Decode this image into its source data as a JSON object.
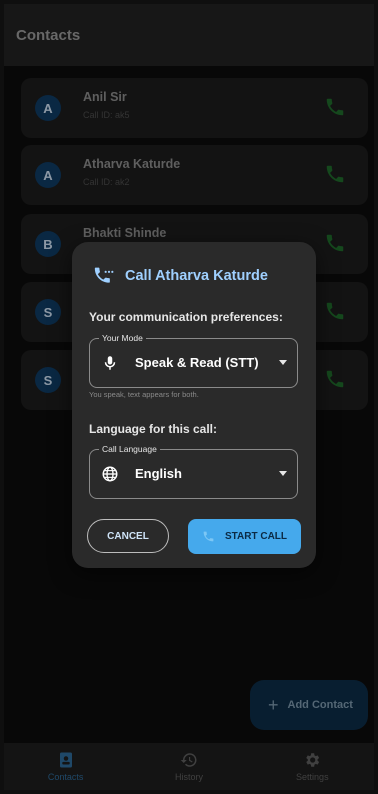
{
  "appbar": {
    "title": "Contacts"
  },
  "contacts": [
    {
      "initial": "A",
      "name": "Anil Sir",
      "sub": "Call ID: ak5"
    },
    {
      "initial": "A",
      "name": "Atharva Katurde",
      "sub": "Call ID: ak2"
    },
    {
      "initial": "B",
      "name": "Bhakti Shinde",
      "sub": ""
    },
    {
      "initial": "S",
      "name": "",
      "sub": ""
    },
    {
      "initial": "S",
      "name": "",
      "sub": ""
    }
  ],
  "fab": {
    "label": "Add Contact"
  },
  "nav": [
    {
      "label": "Contacts",
      "icon": "contacts-icon",
      "active": true
    },
    {
      "label": "History",
      "icon": "history-icon",
      "active": false
    },
    {
      "label": "Settings",
      "icon": "gear-icon",
      "active": false
    }
  ],
  "dialog": {
    "title": "Call Atharva Katurde",
    "prefs_label": "Your communication preferences:",
    "mode": {
      "legend": "Your Mode",
      "value": "Speak & Read (STT)",
      "icon": "microphone-icon",
      "helper": "You speak, text appears for both."
    },
    "lang_label": "Language for this call:",
    "language": {
      "legend": "Call Language",
      "value": "English",
      "icon": "globe-icon"
    },
    "cancel_label": "CANCEL",
    "start_label": "START CALL"
  },
  "colors": {
    "accent": "#45a9ec",
    "title_accent": "#9fd0ff",
    "call_green": "#1f6b2b",
    "avatar_bg": "#0f3b63",
    "background": "#0d0d0d"
  }
}
